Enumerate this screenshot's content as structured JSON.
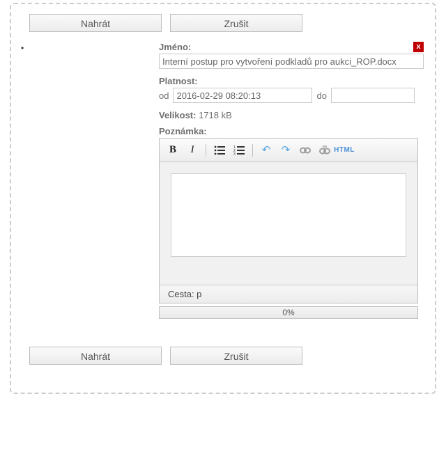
{
  "buttons": {
    "upload": "Nahrát",
    "cancel": "Zrušit"
  },
  "form": {
    "name_label": "Jméno:",
    "name_value": "Interní postup pro vytvoření podkladů pro aukci_ROP.docx",
    "validity_label": "Platnost:",
    "from_label": "od",
    "from_value": "2016-02-29 08:20:13",
    "to_label": "do",
    "to_value": "",
    "size_label": "Velikost:",
    "size_value": "1718 kB",
    "note_label": "Poznámka:"
  },
  "editor": {
    "path_label": "Cesta: p",
    "html_label": "HTML"
  },
  "progress": {
    "percent": "0%"
  },
  "icons": {
    "close": "x"
  }
}
